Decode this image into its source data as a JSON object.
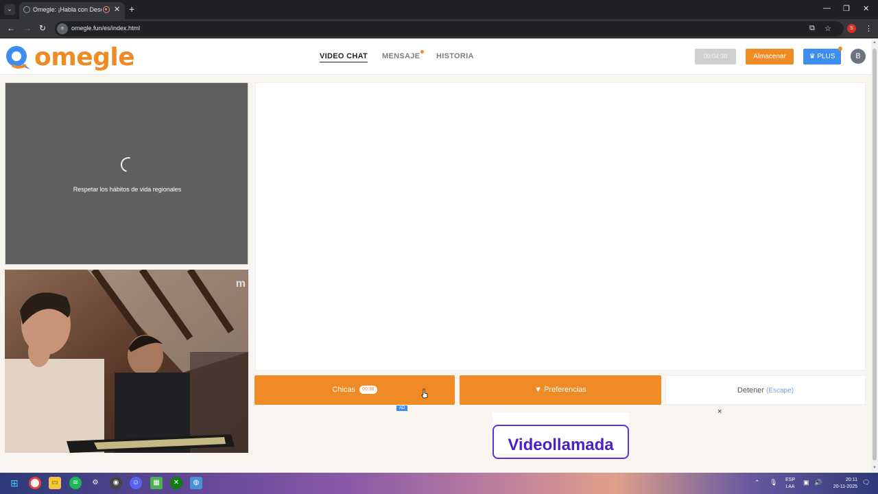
{
  "browser": {
    "tab_title": "Omegle: ¡Habla con Descon",
    "url": "omegle.fun/es/index.html",
    "profile_initial": "S"
  },
  "header": {
    "logo_text": "omegle",
    "nav": [
      {
        "label": "VIDEO CHAT",
        "active": true
      },
      {
        "label": "MENSAJE",
        "active": false
      },
      {
        "label": "HISTORIA",
        "active": false
      }
    ],
    "timer": "00:04:38",
    "store_label": "Almacenar",
    "plus_label": "PLUS",
    "avatar_initial": "B"
  },
  "stranger": {
    "loading_text": "Respetar los hábitos de vida regionales"
  },
  "self_video": {
    "watermark": "m"
  },
  "controls": {
    "girls_label": "Chicas",
    "girls_timer": "00:38",
    "prefs_label": "Preferencias",
    "stop_label": "Detener",
    "stop_hint": "(Escape)"
  },
  "ad": {
    "badge": "AD",
    "close": "×",
    "text": "Videollamada"
  },
  "taskbar": {
    "lang_top": "ESP",
    "lang_bottom": "LAA",
    "time": "20:11",
    "date": "20-11-2025"
  },
  "colors": {
    "brand_orange": "#f08a24",
    "plus_blue": "#3d8ef0",
    "ad_purple": "#4a1fc4"
  }
}
